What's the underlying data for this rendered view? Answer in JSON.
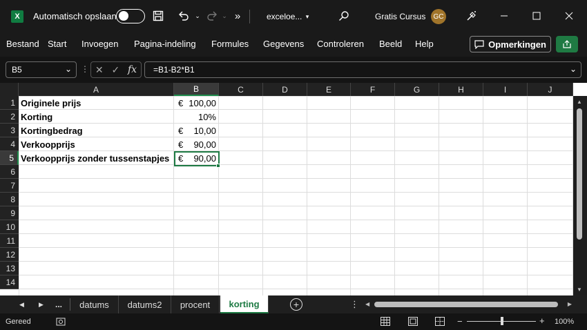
{
  "titlebar": {
    "app_icon": "excel-logo",
    "app_icon_letter": "X",
    "autosave_label": "Automatisch opslaan",
    "file_name": "exceloe...",
    "user_name": "Gratis Cursus",
    "user_initials": "GC"
  },
  "menu": {
    "items": [
      "Bestand",
      "Start",
      "Invoegen",
      "Pagina-indeling",
      "Formules",
      "Gegevens",
      "Controleren",
      "Beeld",
      "Help"
    ],
    "comments_label": "Opmerkingen"
  },
  "formula_bar": {
    "name_box": "B5",
    "fx_label": "fx",
    "formula": "=B1-B2*B1"
  },
  "grid": {
    "columns": [
      "A",
      "B",
      "C",
      "D",
      "E",
      "F",
      "G",
      "H",
      "I",
      "J"
    ],
    "rows": [
      "1",
      "2",
      "3",
      "4",
      "5",
      "6",
      "7",
      "8",
      "9",
      "10",
      "11",
      "12",
      "13",
      "14"
    ],
    "active_cell": "B5",
    "labels": [
      "Originele prijs",
      "Korting",
      "Kortingbedrag",
      "Verkoopprijs",
      "Verkoopprijs zonder tussenstapjes"
    ],
    "values": [
      {
        "currency": "€",
        "amount": "100,00"
      },
      {
        "percent": "10%"
      },
      {
        "currency": "€",
        "amount": "10,00"
      },
      {
        "currency": "€",
        "amount": "90,00"
      },
      {
        "currency": "€",
        "amount": "90,00"
      }
    ]
  },
  "sheets": {
    "ellipsis": "...",
    "tabs": [
      "datums",
      "datums2",
      "procent",
      "korting"
    ],
    "active": "korting",
    "add_symbol": "+"
  },
  "status": {
    "ready_text": "Gereed",
    "zoom_minus": "−",
    "zoom_plus": "+",
    "zoom": "100%",
    "zoom_level": 1.0
  },
  "colors": {
    "accent": "#1d7a43",
    "titlebar": "#1a1a1a",
    "avatar": "#a0742a"
  }
}
